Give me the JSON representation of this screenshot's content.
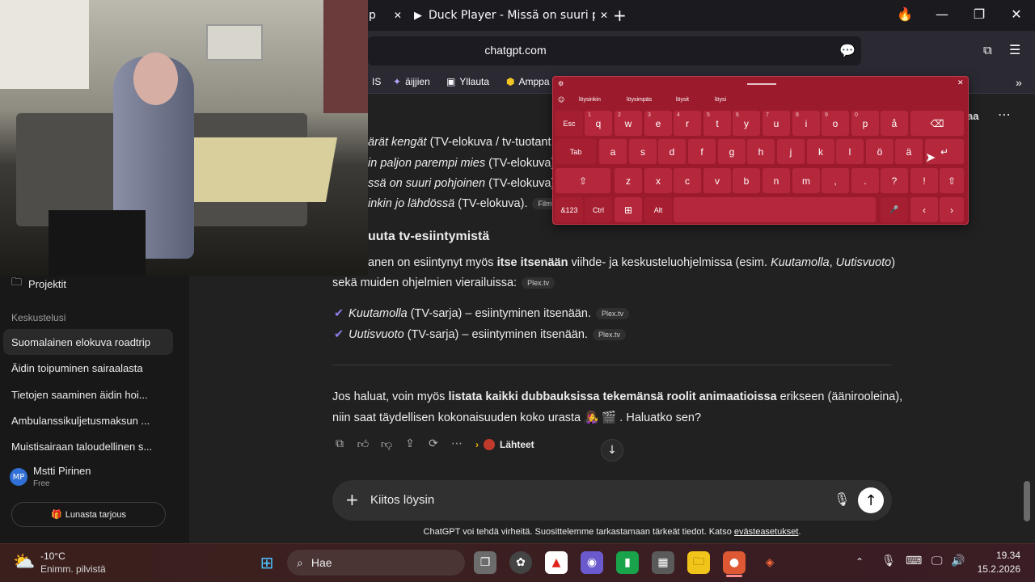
{
  "browser": {
    "tabs": [
      {
        "label": "p",
        "close": "✕"
      },
      {
        "label": "Duck Player - Missä on suuri pohjo",
        "close": "✕"
      }
    ],
    "new_tab": "+",
    "url": "chatgpt.com",
    "bookmarks": [
      "IS",
      "äijjien",
      "Yllauta",
      "Amppa"
    ],
    "window_controls": {
      "minimize": "—",
      "maximize": "❐",
      "close": "✕"
    }
  },
  "sidebar": {
    "projects_label": "Projektit",
    "section_label": "Keskustelusi",
    "chats": [
      "Suomalainen elokuva roadtrip",
      "Äidin toipuminen sairaalasta",
      "Tietojen saaminen äidin hoi...",
      "Ambulanssikuljetusmaksun ...",
      "Muistisairaan taloudellinen s..."
    ],
    "user": {
      "initials": "MP",
      "name": "Mstti Pirinen",
      "plan": "Free"
    },
    "offer_button": "Lunasta tarjous"
  },
  "header": {
    "share_label": "aa",
    "more": "⋯"
  },
  "conversation": {
    "list_lines": [
      {
        "italic": "ärät kengät",
        "rest": " (TV-elokuva / tv-tuotant"
      },
      {
        "italic": "in paljon parempi mies",
        "rest": " (TV-elokuva)."
      },
      {
        "italic": "ssä on suuri pohjoinen",
        "rest": " (TV-elokuva)."
      },
      {
        "italic": "inkin jo lähdössä",
        "rest": " (TV-elokuva).",
        "chip": "FilmBo"
      }
    ],
    "heading": "uuta tv-esiintymistä",
    "para1_a": "anen on esiintynyt myös ",
    "para1_bold": "itse itsenään",
    "para1_b": " viihde- ja keskusteluohjelmissa (esim. ",
    "para1_i1": "Kuutamolla",
    "para1_c": ", ",
    "para1_i2": "Uutisvuoto",
    "para1_d": ")",
    "para2": "sekä muiden ohjelmien vierailuissa:",
    "para2_chip": "Plex.tv",
    "bullets": [
      {
        "italic": "Kuutamolla",
        "rest": " (TV-sarja) – esiintyminen itsenään.",
        "chip": "Plex.tv"
      },
      {
        "italic": "Uutisvuoto",
        "rest": " (TV-sarja) – esiintyminen itsenään.",
        "chip": "Plex.tv"
      }
    ],
    "final_a": "Jos haluat, voin myös ",
    "final_bold": "listata kaikki dubbauksissa tekemänsä roolit animaatioissa",
    "final_b": " erikseen (äänirooleina),",
    "final_line2": "niin saat täydellisen kokonaisuuden koko urasta 👩‍🎤 🎬 . Haluatko sen?",
    "sources_label": "Lähteet"
  },
  "composer": {
    "value": "Kiitos löysin",
    "disclaimer": "ChatGPT voi tehdä virheitä. Suosittelemme tarkastamaan tärkeät tiedot. Katso ",
    "disclaimer_link": "evästeasetukset",
    "disclaimer_end": "."
  },
  "keyboard": {
    "suggestions": [
      "löysinkin",
      "löysimpäs",
      "löysit",
      "löysi"
    ],
    "row1": [
      {
        "k": "Esc"
      },
      {
        "k": "q",
        "s": "1"
      },
      {
        "k": "w",
        "s": "2"
      },
      {
        "k": "e",
        "s": "3"
      },
      {
        "k": "r",
        "s": "4"
      },
      {
        "k": "t",
        "s": "5"
      },
      {
        "k": "y",
        "s": "6"
      },
      {
        "k": "u",
        "s": "7"
      },
      {
        "k": "i",
        "s": "8"
      },
      {
        "k": "o",
        "s": "9"
      },
      {
        "k": "p",
        "s": "0"
      },
      {
        "k": "å"
      },
      {
        "k": "⌫"
      }
    ],
    "row2": [
      {
        "k": "Tab"
      },
      {
        "k": "a"
      },
      {
        "k": "s"
      },
      {
        "k": "d"
      },
      {
        "k": "f"
      },
      {
        "k": "g"
      },
      {
        "k": "h"
      },
      {
        "k": "j"
      },
      {
        "k": "k"
      },
      {
        "k": "l"
      },
      {
        "k": "ö"
      },
      {
        "k": "ä"
      },
      {
        "k": "↵"
      }
    ],
    "row3": [
      {
        "k": "⇧"
      },
      {
        "k": "z"
      },
      {
        "k": "x"
      },
      {
        "k": "c"
      },
      {
        "k": "v"
      },
      {
        "k": "b"
      },
      {
        "k": "n"
      },
      {
        "k": "m"
      },
      {
        "k": ","
      },
      {
        "k": "."
      },
      {
        "k": "?"
      },
      {
        "k": "!"
      },
      {
        "k": "⇧"
      }
    ],
    "row4": [
      {
        "k": "&123"
      },
      {
        "k": "Ctrl"
      },
      {
        "k": "⊞"
      },
      {
        "k": "Alt"
      },
      {
        "k": ""
      },
      {
        "k": "🎤"
      },
      {
        "k": "‹"
      },
      {
        "k": "›"
      }
    ]
  },
  "taskbar": {
    "weather_temp": "-10°C",
    "weather_desc": "Enimm. pilvistä",
    "search_placeholder": "Hae",
    "time": "19.34",
    "date": "15.2.2026"
  }
}
